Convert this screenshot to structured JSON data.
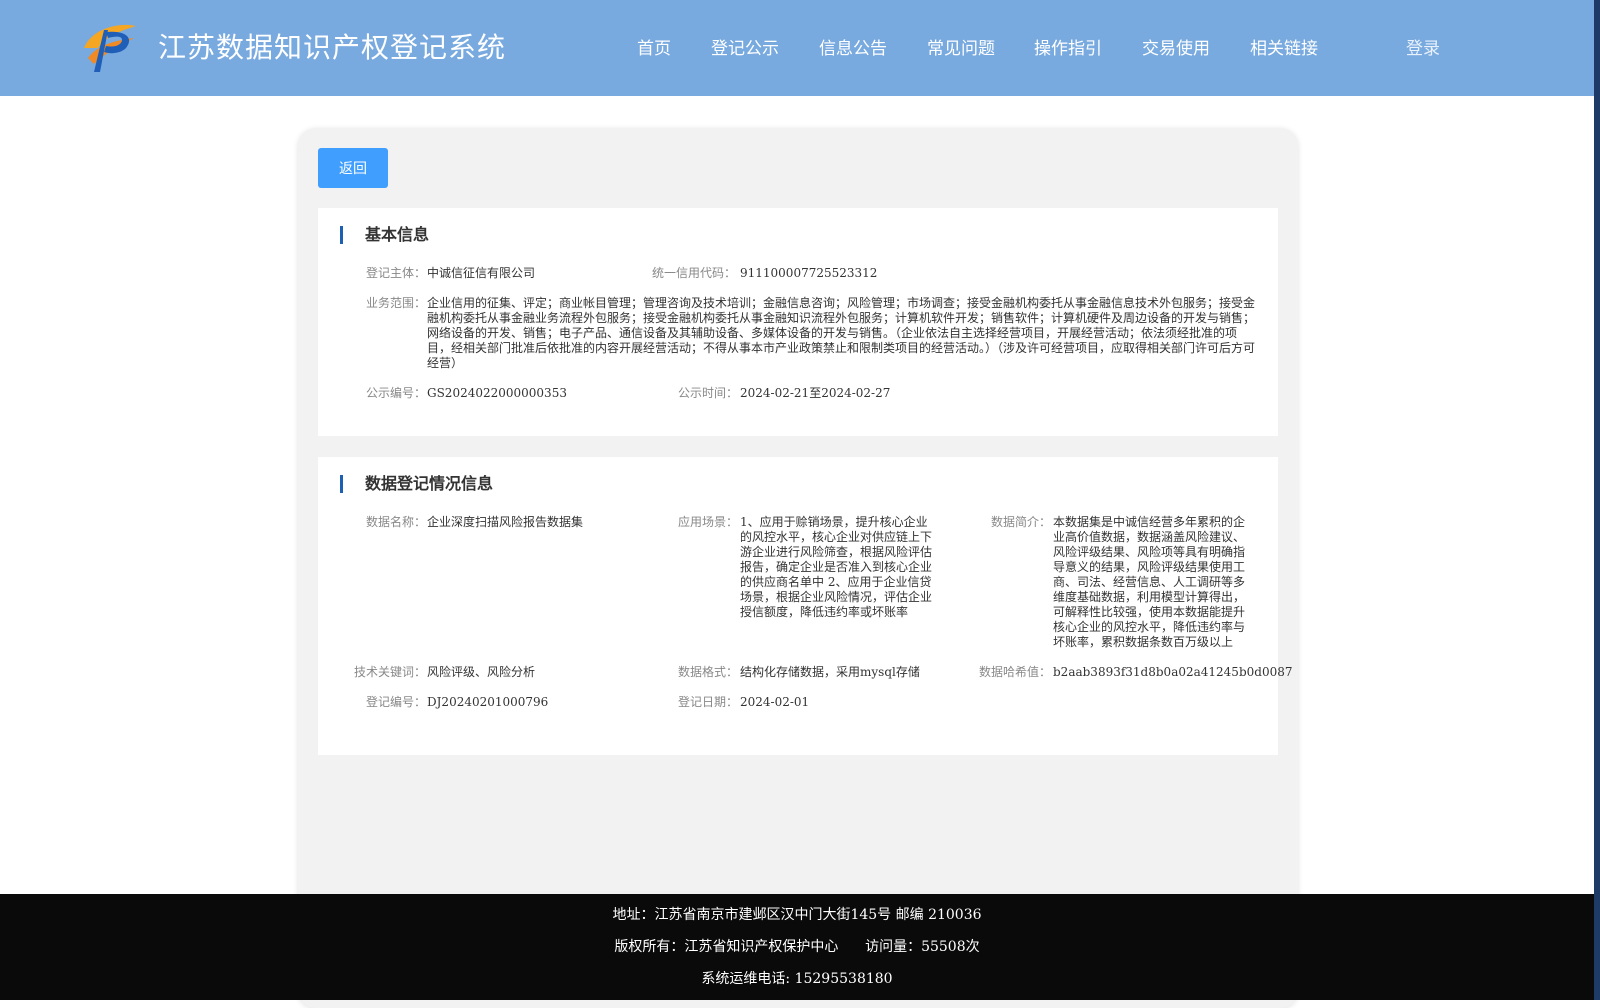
{
  "header": {
    "site_title": "江苏数据知识产权登记系统",
    "login_label": "登录",
    "nav": [
      "首页",
      "登记公示",
      "信息公告",
      "常见问题",
      "操作指引",
      "交易使用",
      "相关链接"
    ]
  },
  "panel": {
    "back_label": "返回",
    "basic": {
      "title": "基本信息",
      "subject_label": "登记主体：",
      "subject_value": "中诚信征信有限公司",
      "credit_label": "统一信用代码：",
      "credit_value": "911100007725523312",
      "scope_label": "业务范围：",
      "scope_value": "企业信用的征集、评定；商业帐目管理；管理咨询及技术培训；金融信息咨询；风险管理；市场调查；接受金融机构委托从事金融信息技术外包服务；接受金融机构委托从事金融业务流程外包服务；接受金融机构委托从事金融知识流程外包服务；计算机软件开发；销售软件；计算机硬件及周边设备的开发与销售；网络设备的开发、销售；电子产品、通信设备及其辅助设备、多媒体设备的开发与销售。（企业依法自主选择经营项目，开展经营活动；依法须经批准的项目，经相关部门批准后依批准的内容开展经营活动；不得从事本市产业政策禁止和限制类项目的经营活动。）（涉及许可经营项目，应取得相关部门许可后方可经营）",
      "notice_no_label": "公示编号：",
      "notice_no_value": "GS2024022000000353",
      "notice_time_label": "公示时间：",
      "notice_time_value": "2024-02-21至2024-02-27"
    },
    "data": {
      "title": "数据登记情况信息",
      "name_label": "数据名称：",
      "name_value": "企业深度扫描风险报告数据集",
      "scene_label": "应用场景：",
      "scene_value": "1、应用于赊销场景，提升核心企业的风控水平，核心企业对供应链上下游企业进行风险筛查，根据风险评估报告，确定企业是否准入到核心企业的供应商名单中 2、应用于企业信贷场景，根据企业风险情况，评估企业授信额度，降低违约率或坏账率",
      "intro_label": "数据简介：",
      "intro_value": "本数据集是中诚信经营多年累积的企业高价值数据，数据涵盖风险建议、风险评级结果、风险项等具有明确指导意义的结果，风险评级结果使用工商、司法、经营信息、人工调研等多维度基础数据，利用模型计算得出，可解释性比较强，使用本数据能提升核心企业的风控水平，降低违约率与坏账率，累积数据条数百万级以上",
      "keywords_label": "技术关键词：",
      "keywords_value": "风险评级、风险分析",
      "format_label": "数据格式：",
      "format_value": "结构化存储数据，采用mysql存储",
      "hash_label": "数据哈希值：",
      "hash_value": "b2aab3893f31d8b0a02a41245b0d0087",
      "reg_no_label": "登记编号：",
      "reg_no_value": "DJ20240201000796",
      "reg_date_label": "登记日期：",
      "reg_date_value": "2024-02-01"
    }
  },
  "footer": {
    "address": "地址：江苏省南京市建邺区汉中门大街145号 邮编 210036",
    "copyright": "版权所有：江苏省知识产权保护中心      访问量：55508次",
    "phone": "系统运维电话: 15295538180"
  },
  "colors": {
    "header_bg": "#78aadf",
    "accent": "#409eff",
    "section_bar": "#1d5fb0",
    "footer_bg": "#0a0a0a"
  }
}
